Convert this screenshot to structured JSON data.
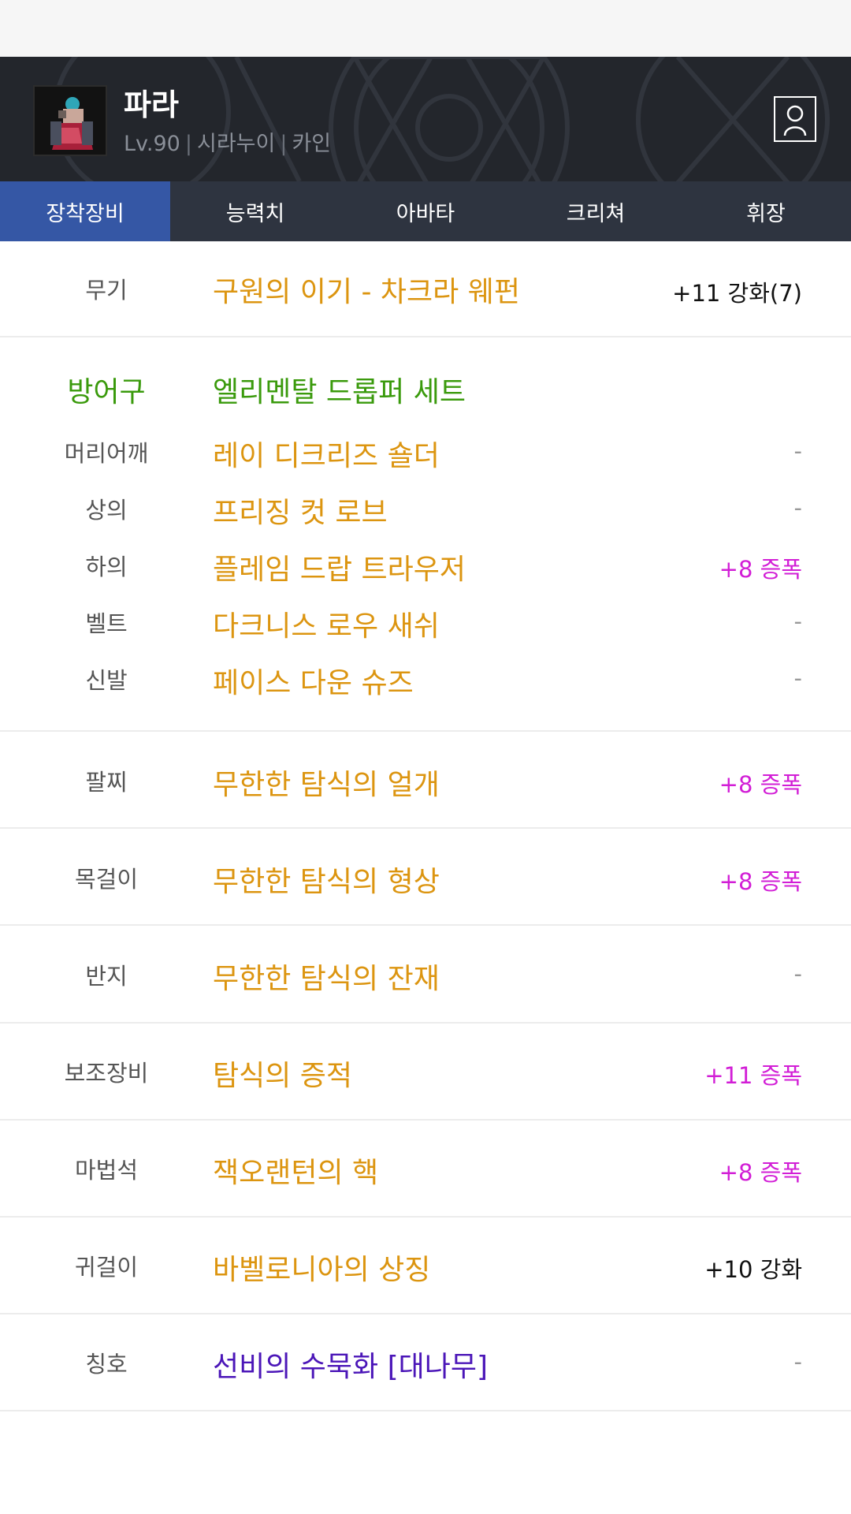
{
  "character": {
    "name": "파라",
    "level": "Lv.90",
    "server": "시라누이",
    "job": "카인"
  },
  "tabs": [
    {
      "label": "장착장비",
      "active": true
    },
    {
      "label": "능력치",
      "active": false
    },
    {
      "label": "아바타",
      "active": false
    },
    {
      "label": "크리쳐",
      "active": false
    },
    {
      "label": "휘장",
      "active": false
    }
  ],
  "equipment": {
    "weapon": {
      "slot": "무기",
      "name": "구원의 이기 - 차크라 웨펀",
      "value": "+11 강화(7)"
    },
    "armor_group": {
      "slot": "방어구",
      "set_name": "엘리멘탈 드롭퍼 세트"
    },
    "shoulder": {
      "slot": "머리어깨",
      "name": "레이 디크리즈 숄더",
      "value": "-"
    },
    "top": {
      "slot": "상의",
      "name": "프리징 컷 로브",
      "value": "-"
    },
    "bottom": {
      "slot": "하의",
      "name": "플레임 드랍 트라우저",
      "value": "+8 증폭"
    },
    "belt": {
      "slot": "벨트",
      "name": "다크니스 로우 새쉬",
      "value": "-"
    },
    "shoes": {
      "slot": "신발",
      "name": "페이스 다운 슈즈",
      "value": "-"
    },
    "bracelet": {
      "slot": "팔찌",
      "name": "무한한 탐식의 얼개",
      "value": "+8 증폭"
    },
    "necklace": {
      "slot": "목걸이",
      "name": "무한한 탐식의 형상",
      "value": "+8 증폭"
    },
    "ring": {
      "slot": "반지",
      "name": "무한한 탐식의 잔재",
      "value": "-"
    },
    "support": {
      "slot": "보조장비",
      "name": "탐식의 증적",
      "value": "+11 증폭"
    },
    "magic_stone": {
      "slot": "마법석",
      "name": "잭오랜턴의 핵",
      "value": "+8 증폭"
    },
    "earring": {
      "slot": "귀걸이",
      "name": "바벨로니아의 상징",
      "value": "+10 강화"
    },
    "title": {
      "slot": "칭호",
      "name": "선비의 수묵화 [대나무]",
      "value": "-"
    }
  },
  "colors": {
    "header_bg": "#23262c",
    "tab_bar_bg": "#2e3440",
    "tab_active_bg": "#3557a5",
    "item_name": "#dc9510",
    "set_name": "#3a9a0c",
    "title_item": "#4b16b8",
    "amplify": "#d21ed6"
  },
  "icons": {
    "avatar": "character-portrait",
    "profile": "person-outline-icon"
  }
}
